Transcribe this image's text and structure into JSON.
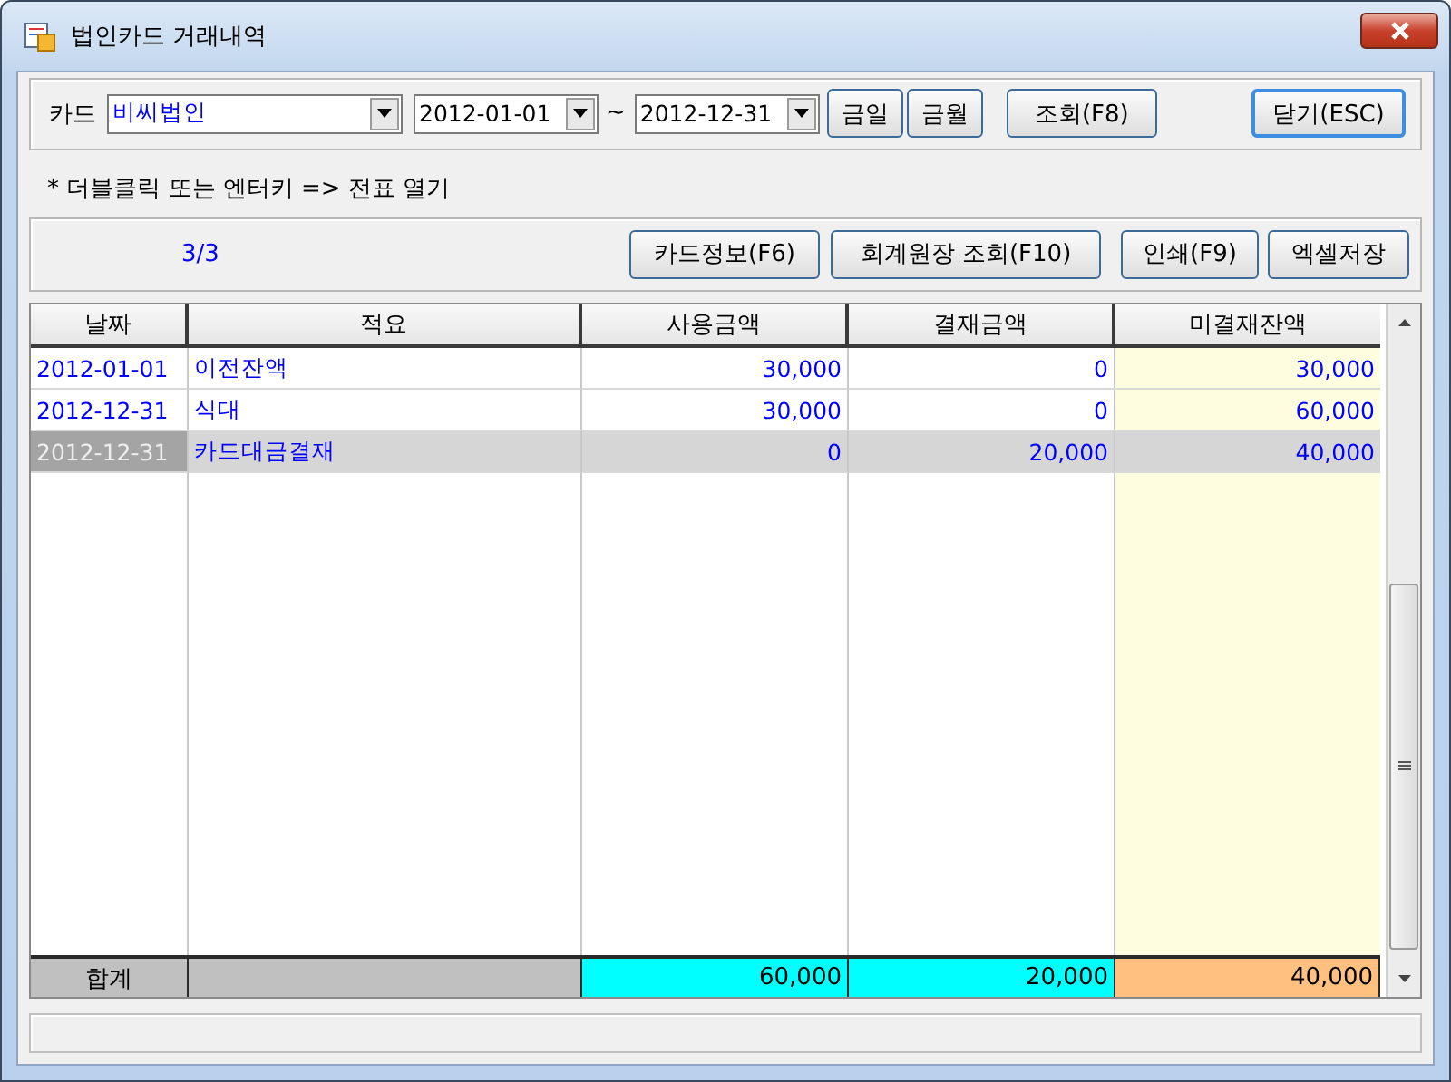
{
  "window": {
    "title": "법인카드 거래내역"
  },
  "filter": {
    "card_label": "카드",
    "card_value": "비씨법인",
    "date_from": "2012-01-01",
    "range_separator": "~",
    "date_to": "2012-12-31",
    "buttons": [
      "금일",
      "금월",
      "조회(F8)"
    ],
    "close_button": "닫기(ESC)"
  },
  "hint": "* 더블클릭 또는 엔터키 => 전표 열기",
  "toolbar": {
    "count": "3/3",
    "buttons": [
      "카드정보(F6)",
      "회계원장 조회(F10)",
      "인쇄(F9)",
      "엑셀저장"
    ]
  },
  "table": {
    "columns": [
      "날짜",
      "적요",
      "사용금액",
      "결재금액",
      "미결재잔액"
    ],
    "rows": [
      {
        "cells": [
          "2012-01-01",
          "이전잔액",
          "30,000",
          "0",
          "30,000"
        ],
        "selected": false
      },
      {
        "cells": [
          "2012-12-31",
          "식대",
          "30,000",
          "0",
          "60,000"
        ],
        "selected": false
      },
      {
        "cells": [
          "2012-12-31",
          "카드대금결재",
          "0",
          "20,000",
          "40,000"
        ],
        "selected": true
      }
    ],
    "totals": {
      "label": "합계",
      "values": [
        "60,000",
        "20,000",
        "40,000"
      ]
    }
  }
}
